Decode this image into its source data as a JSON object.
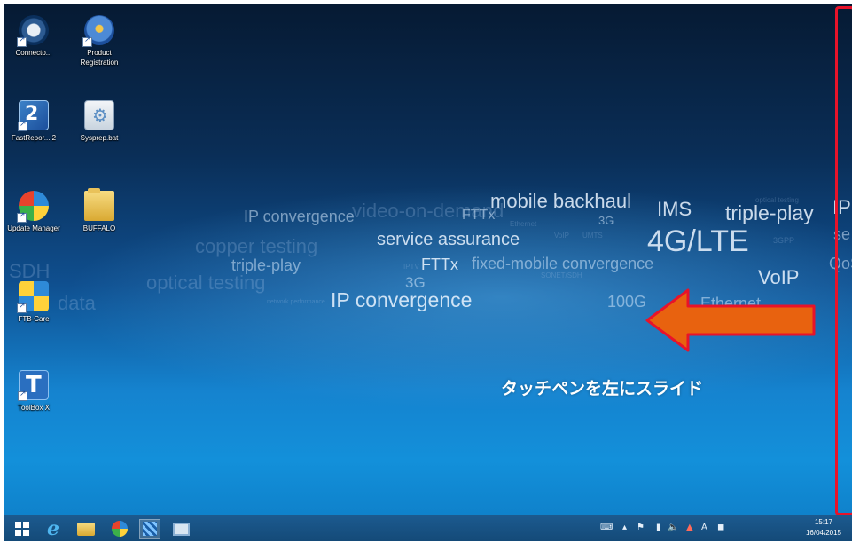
{
  "desktop": {
    "icons": [
      {
        "name": "connectome-icon",
        "label": "Connecto..."
      },
      {
        "name": "product-registration-icon",
        "label": "Product Registration"
      },
      {
        "name": "fastreport-icon",
        "label": "FastRepor... 2"
      },
      {
        "name": "sysprep-icon",
        "label": "Sysprep.bat"
      },
      {
        "name": "update-manager-icon",
        "label": "Update Manager"
      },
      {
        "name": "buffalo-folder-icon",
        "label": "BUFFALO"
      },
      {
        "name": "ftb-care-icon",
        "label": "FTB-Care"
      },
      {
        "name": "toolbox-x-icon",
        "label": "ToolBox X"
      }
    ]
  },
  "wallpaper_words": [
    "mobile backhaul",
    "IMS",
    "optical testing",
    "triple-play",
    "IP",
    "IP convergence",
    "video-on-demand",
    "FTTx",
    "3G",
    "Ethernet",
    "service assurance",
    "VoIP",
    "UMTS",
    "4G/LTE",
    "3GPP",
    "triple-play",
    "FTTx",
    "fixed-mobile convergence",
    "copper testing",
    "IPTV",
    "VoIP",
    "optical testing",
    "3G",
    "SONET/SDH",
    "IP convergence",
    "100G",
    "Ethernet",
    "network performance",
    "data",
    "SDH",
    "QoS",
    "se"
  ],
  "overlay": {
    "caption": "タッチペンを左にスライド"
  },
  "taskbar": {
    "buttons": [
      "start-icon",
      "internet-explorer-icon",
      "file-explorer-icon",
      "app-icon-1",
      "app-icon-2",
      "app-icon-3"
    ],
    "tray_ime": "A",
    "clock_time": "15:17",
    "clock_date": "16/04/2015"
  },
  "colors": {
    "highlight_border": "#e8132a",
    "arrow_fill": "#e8620f",
    "arrow_stroke": "#e8132a",
    "taskbar": "#174e80"
  }
}
